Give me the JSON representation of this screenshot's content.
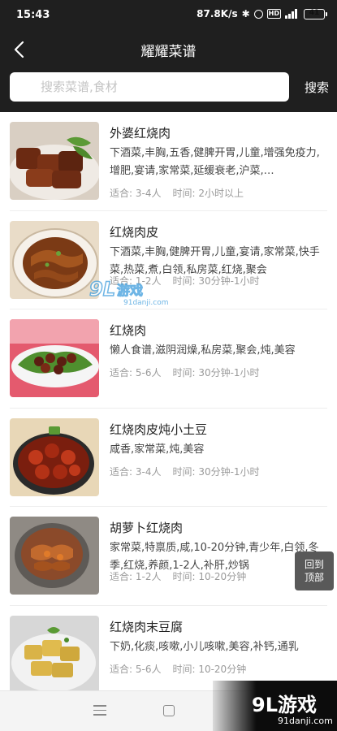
{
  "status_bar": {
    "time": "15:43",
    "network_speed": "87.8K/s",
    "network_type": "4G",
    "battery": "41",
    "icons": [
      "bluetooth-icon",
      "alarm-icon",
      "hd-icon",
      "signal-icon",
      "battery-icon"
    ]
  },
  "header": {
    "title": "耀耀菜谱",
    "back_icon": "chevron-left-icon"
  },
  "search": {
    "placeholder": "搜索菜谱,食材",
    "button_label": "搜索"
  },
  "recipes": [
    {
      "name": "外婆红烧肉",
      "tags": "下酒菜,丰胸,五香,健脾开胃,儿童,增强免疫力,增肥,宴请,家常菜,延缓衰老,沪菜,…",
      "servings": "适合: 3-4人",
      "time": "时间: 2小时以上"
    },
    {
      "name": "红烧肉皮",
      "tags": "下酒菜,丰胸,健脾开胃,儿童,宴请,家常菜,快手菜,热菜,煮,白领,私房菜,红烧,聚会",
      "servings": "适合: 1-2人",
      "time": "时间: 30分钟-1小时"
    },
    {
      "name": "红烧肉",
      "tags": "懒人食谱,滋阴润燥,私房菜,聚会,炖,美容",
      "servings": "适合: 5-6人",
      "time": "时间: 30分钟-1小时"
    },
    {
      "name": "红烧肉皮炖小土豆",
      "tags": "咸香,家常菜,炖,美容",
      "servings": "适合: 3-4人",
      "time": "时间: 30分钟-1小时"
    },
    {
      "name": "胡萝卜红烧肉",
      "tags": "家常菜,特禀质,咸,10-20分钟,青少年,白领,冬季,红烧,养颜,1-2人,补肝,炒锅",
      "servings": "适合: 1-2人",
      "time": "时间: 10-20分钟"
    },
    {
      "name": "红烧肉末豆腐",
      "tags": "下奶,化痰,咳嗽,小儿咳嗽,美容,补钙,通乳",
      "servings": "适合: 5-6人",
      "time": "时间: 10-20分钟"
    }
  ],
  "back_to_top": {
    "line1": "回到",
    "line2": "顶部"
  },
  "watermark": {
    "logo": "9L",
    "name": "游戏",
    "corner_logo": "9L游戏",
    "url": "91danji.com",
    "corner_url": "91danji.com"
  },
  "colors": {
    "header_bg": "#1f1f1f",
    "battery": "#7dd23a",
    "muted_text": "#9a9a9a"
  }
}
